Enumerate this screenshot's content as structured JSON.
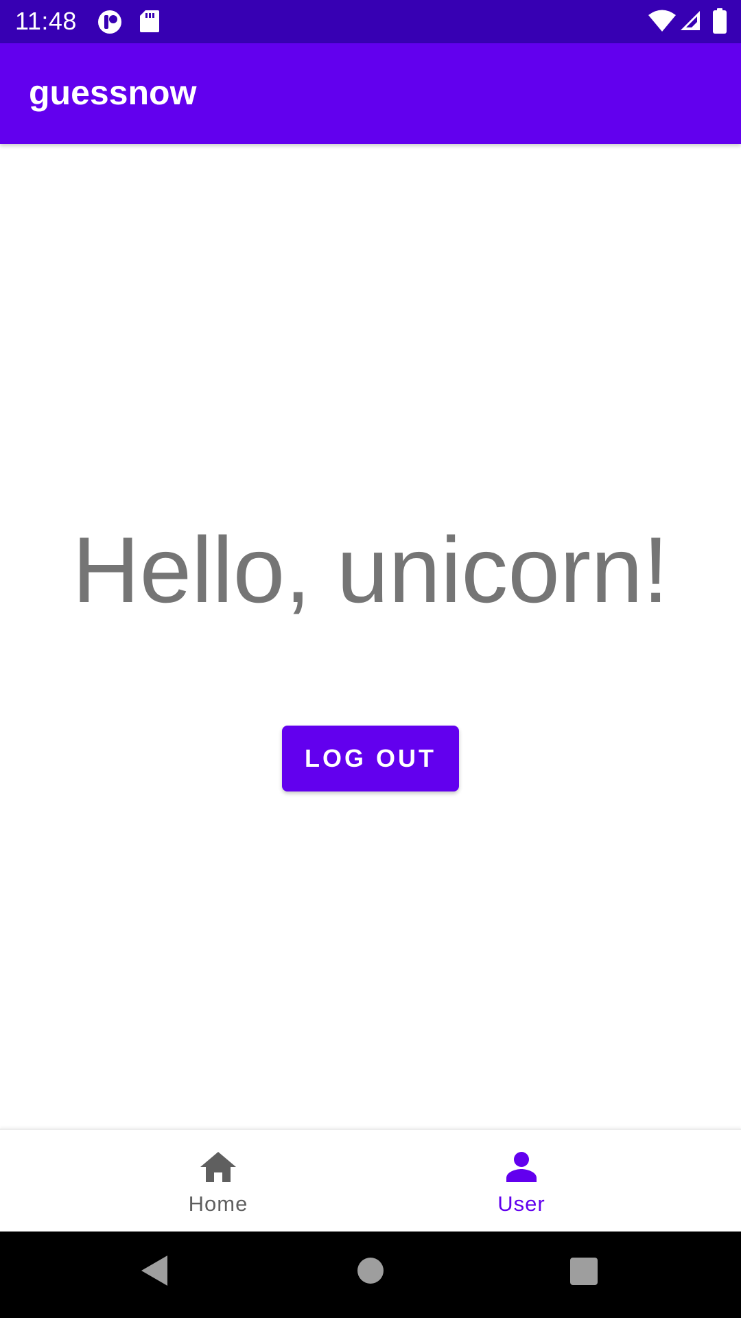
{
  "status_bar": {
    "time": "11:48",
    "icons": [
      "app-notification-icon",
      "sd-card-icon",
      "wifi-icon",
      "cellular-signal-icon",
      "battery-icon"
    ]
  },
  "app_bar": {
    "title": "guessnow"
  },
  "main": {
    "greeting": "Hello, unicorn!",
    "logout_label": "LOG OUT"
  },
  "bottom_nav": {
    "items": [
      {
        "label": "Home",
        "icon": "home-icon",
        "selected": false
      },
      {
        "label": "User",
        "icon": "person-icon",
        "selected": true
      }
    ]
  },
  "colors": {
    "primary": "#6200EE",
    "primary_dark": "#3700B3",
    "greeting_text": "#757575",
    "inactive_nav": "#5f5f5f"
  },
  "system_nav": {
    "buttons": [
      "back-icon",
      "home-circle-icon",
      "recents-icon"
    ]
  }
}
